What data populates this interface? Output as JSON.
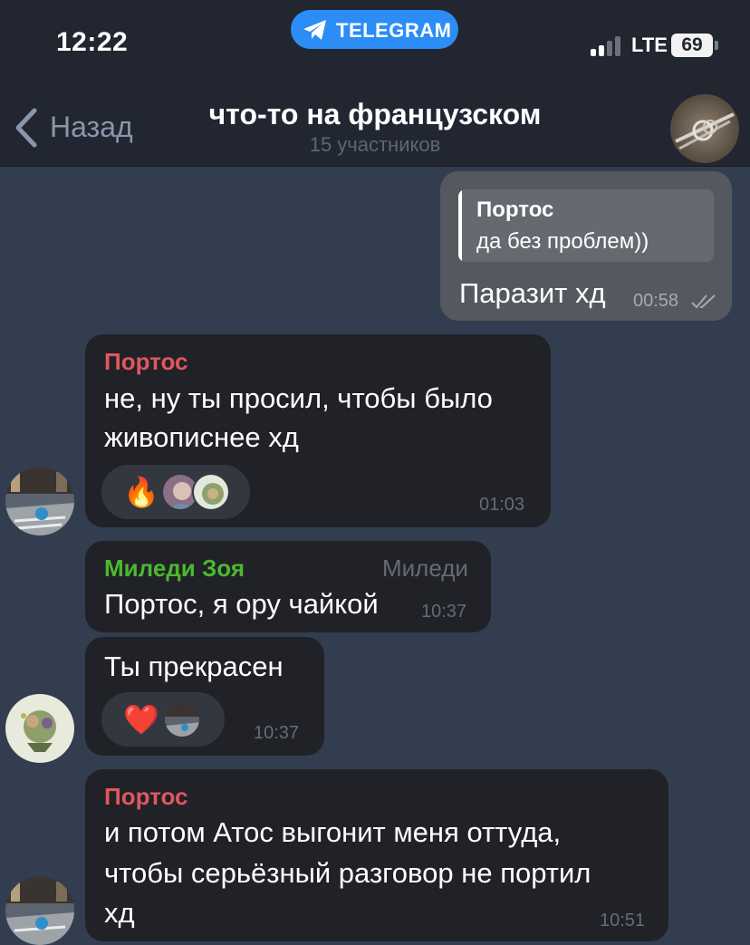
{
  "status_bar": {
    "time": "12:22",
    "app_pill": "TELEGRAM",
    "network": "LTE",
    "battery": "69"
  },
  "header": {
    "back_label": "Назад",
    "title": "что-то на французском",
    "subtitle": "15 участников"
  },
  "messages": [
    {
      "direction": "outgoing",
      "reply": {
        "name": "Портос",
        "text": "да без проблем))"
      },
      "text": "Паразит хд",
      "time": "00:58",
      "status": "read"
    },
    {
      "direction": "incoming",
      "sender": "Портос",
      "sender_color": "#e0575f",
      "lines": [
        "не, ну ты просил, чтобы было",
        "живописнее хд"
      ],
      "reactions": [
        {
          "emoji": "🔥",
          "users": 2
        }
      ],
      "time": "01:03"
    },
    {
      "direction": "incoming",
      "sender": "Миледи Зоя",
      "sender_color": "#4cb82f",
      "admin_title": "Миледи",
      "text": "Портос, я ору чайкой",
      "time": "10:37"
    },
    {
      "direction": "incoming",
      "text": "Ты прекрасен",
      "reactions": [
        {
          "emoji": "❤️",
          "users": 1
        }
      ],
      "time": "10:37"
    },
    {
      "direction": "incoming",
      "sender": "Портос",
      "sender_color": "#e0575f",
      "lines": [
        "и потом Атос выгонит меня оттуда,",
        "чтобы серьёзный разговор не портил",
        "хд"
      ],
      "time": "10:51"
    }
  ],
  "colors": {
    "background": "#323d50",
    "header": "#212630",
    "incoming_bubble": "#212227",
    "outgoing_bubble": "#55585f",
    "accent": "#2b8df5"
  }
}
